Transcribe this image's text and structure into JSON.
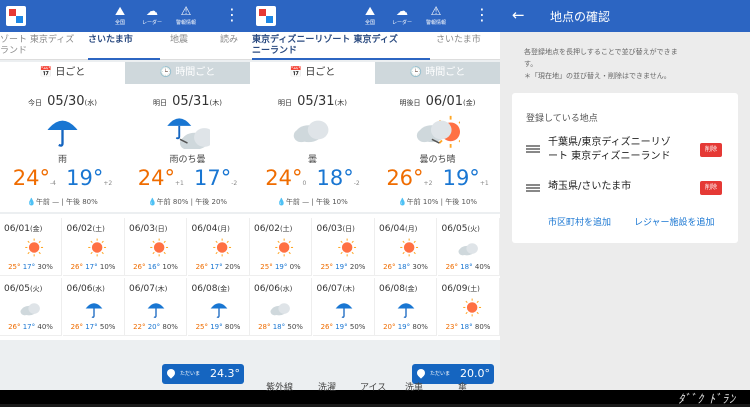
{
  "toolbar": {
    "icons": [
      {
        "name": "japan-map-icon",
        "glyph": "⛰",
        "label": "全国"
      },
      {
        "name": "radar-icon",
        "glyph": "☁",
        "label": "レーダー"
      },
      {
        "name": "alert-icon",
        "glyph": "⚠",
        "label": "警報情報"
      }
    ]
  },
  "p1": {
    "tabs": [
      {
        "text": "ゾート 東京ディズ\nランド"
      },
      {
        "text": "さいたま市"
      },
      {
        "text": "地震"
      },
      {
        "text": "読み"
      }
    ],
    "day_tab": "日ごと",
    "hour_tab": "時間ごと",
    "today": [
      {
        "p": "今日",
        "d": "05/30",
        "w": "(水)",
        "desc": "雨",
        "hi": "24°",
        "hd": "-4",
        "lo": "19°",
        "ld": "+2",
        "am": "午前 —",
        "pm": "午後 80%"
      },
      {
        "p": "明日",
        "d": "05/31",
        "w": "(木)",
        "desc": "雨のち曇",
        "hi": "24°",
        "hd": "+1",
        "lo": "17°",
        "ld": "-2",
        "am": "午前 80%",
        "pm": "午後 20%"
      }
    ],
    "week": [
      {
        "d": "06/01",
        "w": "(金)",
        "hi": "25°",
        "lo": "17°",
        "p": "30%",
        "i": "sunny"
      },
      {
        "d": "06/02",
        "w": "(土)",
        "hi": "26°",
        "lo": "17°",
        "p": "10%",
        "i": "sunny"
      },
      {
        "d": "06/03",
        "w": "(日)",
        "hi": "26°",
        "lo": "16°",
        "p": "10%",
        "i": "sunny"
      },
      {
        "d": "06/04",
        "w": "(月)",
        "hi": "26°",
        "lo": "17°",
        "p": "20%",
        "i": "sunny"
      },
      {
        "d": "06/05",
        "w": "(火)",
        "hi": "26°",
        "lo": "17°",
        "p": "40%",
        "i": "cloudy"
      },
      {
        "d": "06/06",
        "w": "(水)",
        "hi": "26°",
        "lo": "17°",
        "p": "50%",
        "i": "rain"
      },
      {
        "d": "06/07",
        "w": "(木)",
        "hi": "22°",
        "lo": "20°",
        "p": "80%",
        "i": "rain"
      },
      {
        "d": "06/08",
        "w": "(金)",
        "hi": "25°",
        "lo": "19°",
        "p": "80%",
        "i": "rain"
      }
    ],
    "pill": {
      "k": "ただいま",
      "v": "24.3°"
    }
  },
  "p2": {
    "tabs": [
      {
        "text": "東京ディズニーリゾート 東京ディズ\nニーランド"
      },
      {
        "text": "さいたま市"
      }
    ],
    "day_tab": "日ごと",
    "hour_tab": "時間ごと",
    "today": [
      {
        "p": "明日",
        "d": "05/31",
        "w": "(木)",
        "desc": "曇",
        "hi": "24°",
        "hd": "0",
        "lo": "18°",
        "ld": "-2",
        "am": "午前 —",
        "pm": "午後 10%"
      },
      {
        "p": "明後日",
        "d": "06/01",
        "w": "(金)",
        "desc": "曇のち晴",
        "hi": "26°",
        "hd": "+2",
        "lo": "19°",
        "ld": "+1",
        "am": "午前 10%",
        "pm": "午後 10%"
      }
    ],
    "week": [
      {
        "d": "06/02",
        "w": "(土)",
        "hi": "25°",
        "lo": "19°",
        "p": "0%",
        "i": "sunny"
      },
      {
        "d": "06/03",
        "w": "(日)",
        "hi": "25°",
        "lo": "19°",
        "p": "20%",
        "i": "sunny"
      },
      {
        "d": "06/04",
        "w": "(月)",
        "hi": "26°",
        "lo": "18°",
        "p": "30%",
        "i": "sunny"
      },
      {
        "d": "06/05",
        "w": "(火)",
        "hi": "26°",
        "lo": "18°",
        "p": "40%",
        "i": "cloudy"
      },
      {
        "d": "06/06",
        "w": "(水)",
        "hi": "28°",
        "lo": "18°",
        "p": "50%",
        "i": "cloudy"
      },
      {
        "d": "06/07",
        "w": "(木)",
        "hi": "26°",
        "lo": "19°",
        "p": "50%",
        "i": "rain"
      },
      {
        "d": "06/08",
        "w": "(金)",
        "hi": "20°",
        "lo": "19°",
        "p": "80%",
        "i": "rain"
      },
      {
        "d": "06/09",
        "w": "(土)",
        "hi": "23°",
        "lo": "18°",
        "p": "80%",
        "i": "sunny"
      }
    ],
    "pill": {
      "k": "ただいま",
      "v": "20.0°"
    }
  },
  "bottom_tabs": [
    "紫外線",
    "洗濯",
    "アイス",
    "洗車",
    "傘"
  ],
  "p3": {
    "title": "地点の確認",
    "note1": "各登録地点を長押しすることで並び替えができま",
    "note1b": "す。",
    "note2": "＊「現在地」の並び替え・削除はできません。",
    "card_head": "登録している地点",
    "locations": [
      {
        "name": "千葉県/東京ディズニーリゾ\nート 東京ディズニーランド",
        "del": "削除"
      },
      {
        "name": "埼玉県/さいたま市",
        "del": "削除"
      }
    ],
    "add_city": "市区町村を追加",
    "add_leisure": "レジャー施設を追加"
  },
  "watermark": "ﾀﾞﾞｸ ﾄﾞﾗﾝ",
  "colors": {
    "header": "#2c65c2",
    "hi_temp": "#ef6c00",
    "lo_temp": "#1976d2",
    "delete": "#e53935"
  }
}
